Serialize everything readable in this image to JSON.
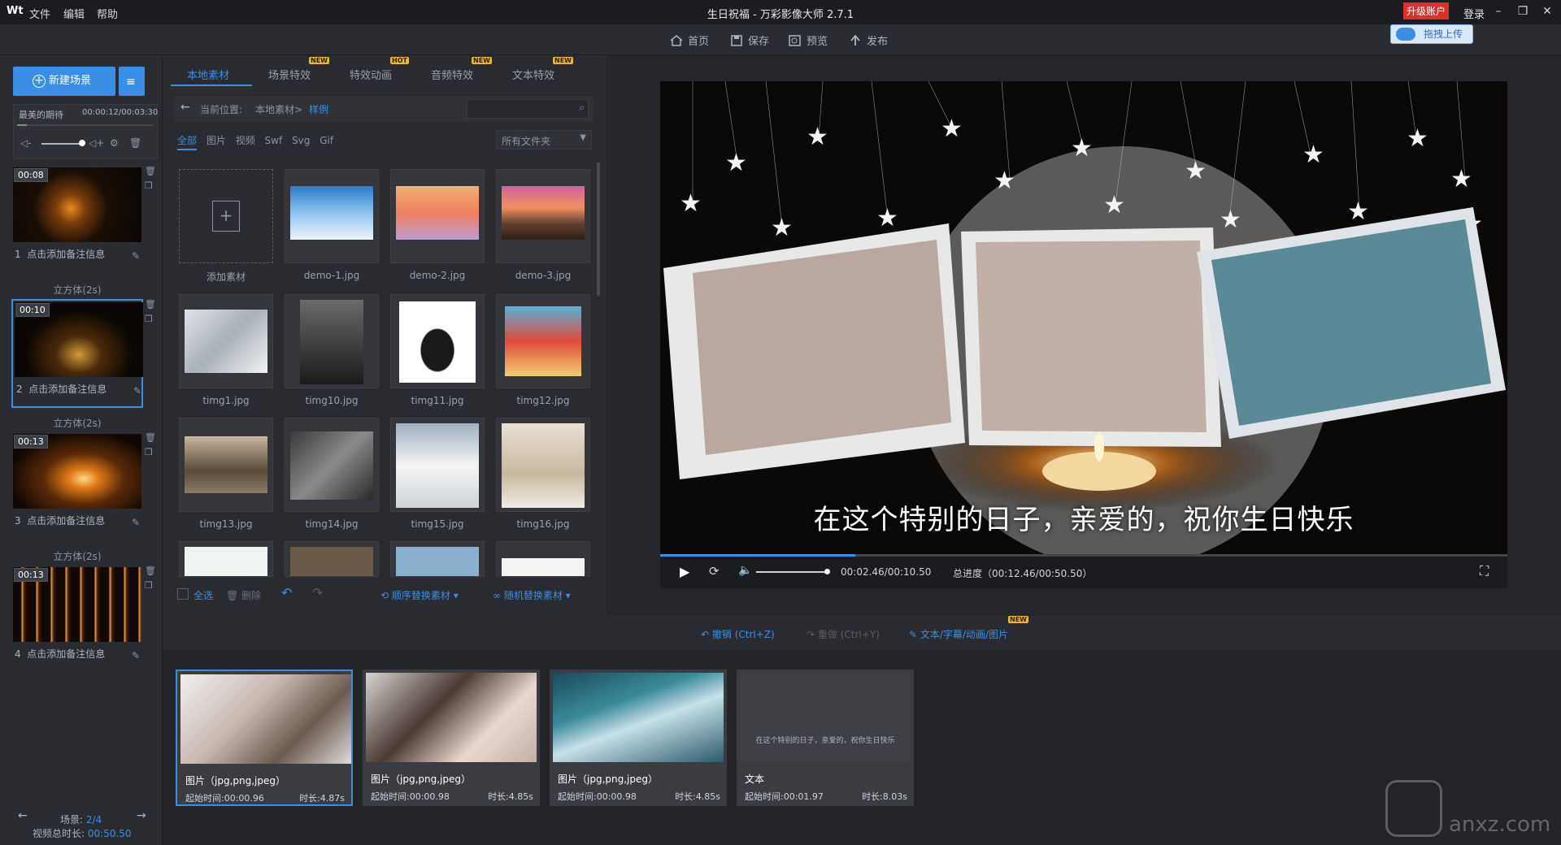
{
  "app": {
    "logo": "Wt",
    "title": "生日祝福 - 万彩影像大师 2.7.1",
    "menu": [
      "文件",
      "编辑",
      "帮助"
    ],
    "upgrade": "升级账户",
    "login": "登录",
    "upload": "拖拽上传"
  },
  "toolbar": {
    "items": [
      "首页",
      "保存",
      "预览",
      "发布"
    ]
  },
  "left": {
    "new_scene": "新建场景",
    "music_name": "最美的期待",
    "music_time": "00:00:12/00:03:30",
    "scenes": [
      {
        "time": "00:08",
        "index": "1",
        "note": "点击添加备注信息"
      },
      {
        "time": "00:10",
        "index": "2",
        "note": "点击添加备注信息"
      },
      {
        "time": "00:13",
        "index": "3",
        "note": "点击添加备注信息"
      },
      {
        "time": "00:13",
        "index": "4",
        "note": "点击添加备注信息"
      }
    ],
    "transitions": [
      "立方体(2s)",
      "立方体(2s)",
      "立方体(2s)"
    ],
    "scene_label": "场景:",
    "scene_count": "2/4",
    "total_label": "视频总时长:",
    "total_time": "00:50.50"
  },
  "mid": {
    "tabs": [
      {
        "label": "本地素材",
        "badge": ""
      },
      {
        "label": "场景特效",
        "badge": "NEW"
      },
      {
        "label": "特效动画",
        "badge": "HOT"
      },
      {
        "label": "音频特效",
        "badge": "NEW"
      },
      {
        "label": "文本特效",
        "badge": "NEW"
      }
    ],
    "location_label": "当前位置:",
    "location_path": "本地素材>",
    "location_current": "样例",
    "filters": [
      "全部",
      "图片",
      "视频",
      "Swf",
      "Svg",
      "Gif"
    ],
    "folder_select": "所有文件夹",
    "add_material": "添加素材",
    "materials": [
      "demo-1.jpg",
      "demo-2.jpg",
      "demo-3.jpg",
      "timg1.jpg",
      "timg10.jpg",
      "timg11.jpg",
      "timg12.jpg",
      "timg13.jpg",
      "timg14.jpg",
      "timg15.jpg",
      "timg16.jpg"
    ],
    "select_all": "全选",
    "delete": "删除",
    "seq_replace": "顺序替换素材",
    "rand_replace": "随机替换素材"
  },
  "preview": {
    "caption": "在这个特别的日子，亲爱的，祝你生日快乐",
    "time": "00:02.46/00:10.50",
    "total": "总进度（00:12.46/00:50.50）",
    "progress": 0.23
  },
  "actions": {
    "undo": "撤销 (Ctrl+Z)",
    "redo": "重做 (Ctrl+Y)",
    "text": "文本/字幕/动画/图片",
    "badge": "NEW"
  },
  "timeline": [
    {
      "type": "图片（jpg,png,jpeg）",
      "start": "起始时间:00:00.96",
      "dur": "时长:4.87s"
    },
    {
      "type": "图片（jpg,png,jpeg）",
      "start": "起始时间:00:00.98",
      "dur": "时长:4.85s"
    },
    {
      "type": "图片（jpg,png,jpeg）",
      "start": "起始时间:00:00.98",
      "dur": "时长:4.85s"
    },
    {
      "type": "文本",
      "start": "起始时间:00:01.97",
      "dur": "时长:8.03s",
      "preview": "在这个特别的日子，亲爱的，祝你生日快乐"
    }
  ],
  "watermark": "anxz.com"
}
